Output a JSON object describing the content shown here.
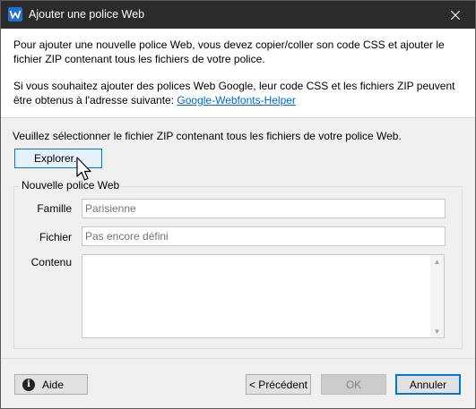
{
  "window": {
    "title": "Ajouter une police Web",
    "app_icon": "app-logo-icon",
    "close_icon": "close-icon"
  },
  "info": {
    "paragraph1": "Pour ajouter une nouvelle police Web, vous devez copier/coller son code CSS et ajouter le fichier ZIP contenant tous les fichiers de votre police.",
    "paragraph2_prefix": "Si vous souhaitez ajouter des polices Web Google, leur code CSS et les fichiers ZIP peuvent être obtenus à l'adresse suivante: ",
    "link_text": "Google-Webfonts-Helper"
  },
  "instruction": "Veuillez sélectionner le fichier ZIP contenant tous les fichiers de votre police Web.",
  "explore_button": "Explorer...",
  "group": {
    "legend": "Nouvelle police Web",
    "family_label": "Famille",
    "family_placeholder": "Parisienne",
    "file_label": "Fichier",
    "file_placeholder": "Pas encore défini",
    "content_label": "Contenu",
    "content_value": ""
  },
  "footer": {
    "help_label": "Aide",
    "help_icon": "info-icon",
    "prev_label": "< Précédent",
    "ok_label": "OK",
    "cancel_label": "Annuler"
  },
  "colors": {
    "titlebar": "#2b2b2b",
    "accent": "#0078d7",
    "link": "#0066cc"
  }
}
